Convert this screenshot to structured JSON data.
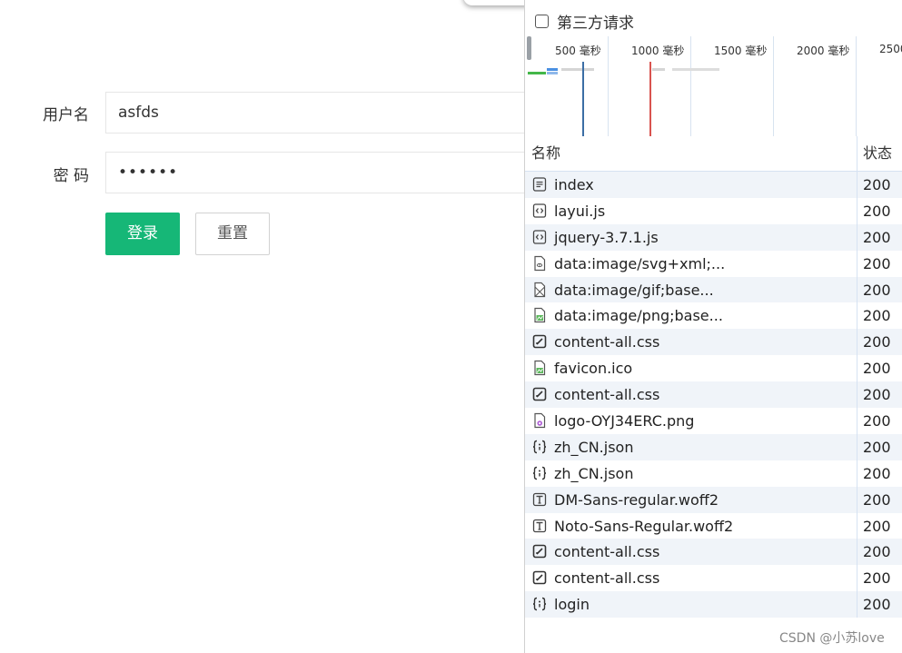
{
  "form": {
    "username_label": "用户名",
    "username_value": "asfds",
    "password_label": "密 码",
    "password_value": "••••••",
    "login_label": "登录",
    "reset_label": "重置"
  },
  "devtools": {
    "filter_label": "第三方请求",
    "timeline_ticks": [
      "500 毫秒",
      "1000 毫秒",
      "1500 毫秒",
      "2000 毫秒",
      "2500"
    ],
    "col_name": "名称",
    "col_status": "状态",
    "rows": [
      {
        "icon": "document-icon",
        "name": "index",
        "status": "200"
      },
      {
        "icon": "script-icon",
        "name": "layui.js",
        "status": "200"
      },
      {
        "icon": "script-icon",
        "name": "jquery-3.7.1.js",
        "status": "200"
      },
      {
        "icon": "svg-image-icon",
        "name": "data:image/svg+xml;...",
        "status": "200"
      },
      {
        "icon": "gif-image-icon",
        "name": "data:image/gif;base...",
        "status": "200"
      },
      {
        "icon": "png-image-icon",
        "name": "data:image/png;base...",
        "status": "200"
      },
      {
        "icon": "stylesheet-icon",
        "name": "content-all.css",
        "status": "200"
      },
      {
        "icon": "png-image-icon",
        "name": "favicon.ico",
        "status": "200"
      },
      {
        "icon": "stylesheet-icon",
        "name": "content-all.css",
        "status": "200"
      },
      {
        "icon": "logo-image-icon",
        "name": "logo-OYJ34ERC.png",
        "status": "200"
      },
      {
        "icon": "json-icon",
        "name": "zh_CN.json",
        "status": "200"
      },
      {
        "icon": "json-icon",
        "name": "zh_CN.json",
        "status": "200"
      },
      {
        "icon": "font-icon",
        "name": "DM-Sans-regular.woff2",
        "status": "200"
      },
      {
        "icon": "font-icon",
        "name": "Noto-Sans-Regular.woff2",
        "status": "200"
      },
      {
        "icon": "stylesheet-icon",
        "name": "content-all.css",
        "status": "200"
      },
      {
        "icon": "stylesheet-icon",
        "name": "content-all.css",
        "status": "200"
      },
      {
        "icon": "json-icon",
        "name": "login",
        "status": "200"
      }
    ]
  },
  "watermark": "CSDN @小苏love",
  "colors": {
    "primary": "#16b777",
    "alt_row": "#f0f4f9",
    "dom_line": "#3b6ea5",
    "load_line": "#d9534f"
  }
}
